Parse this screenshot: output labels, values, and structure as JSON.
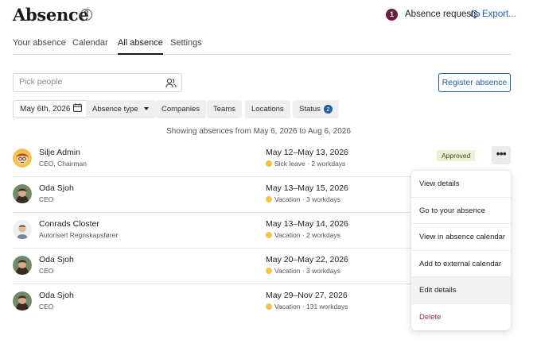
{
  "header": {
    "title": "Absence",
    "help_icon": "question-circle-icon",
    "requests_count": "1",
    "requests_label": "Absence requests",
    "export_label": "Export...",
    "accent_color": "#1f5fa6",
    "badge_color": "#6b1d3b"
  },
  "tabs": [
    {
      "label": "Your absence",
      "active": false
    },
    {
      "label": "Calendar",
      "active": false
    },
    {
      "label": "All absence",
      "active": true
    },
    {
      "label": "Settings",
      "active": false
    }
  ],
  "search": {
    "placeholder": "Pick people",
    "value": ""
  },
  "register_label": "Register absence",
  "filters": {
    "date": "May 6th, 2026",
    "absence_type": "Absence type",
    "companies": "Companies",
    "teams": "Teams",
    "locations": "Locations",
    "status": "Status",
    "status_count": "2"
  },
  "showing_text": "Showing absences from May 6, 2026 to Aug 6, 2026",
  "rows": [
    {
      "name": "Silje Admin",
      "role": "CEO, Chairman",
      "dates": "May 12–May 13, 2026",
      "type": "Sick leave",
      "workdays": "2 workdays",
      "status": "Approved",
      "avatar": "cartoon"
    },
    {
      "name": "Oda Sjoh",
      "role": "CEO",
      "dates": "May 13–May 15, 2026",
      "type": "Vacation",
      "workdays": "3 workdays",
      "avatar": "photo"
    },
    {
      "name": "Conrads Closter",
      "role": "Autorisert Regnskapsfører",
      "dates": "May 13–May 14, 2026",
      "type": "Vacation",
      "workdays": "2 workdays",
      "avatar": "photo-man"
    },
    {
      "name": "Oda Sjoh",
      "role": "CEO",
      "dates": "May 20–May 22, 2026",
      "type": "Vacation",
      "workdays": "3 workdays",
      "avatar": "photo"
    },
    {
      "name": "Oda Sjoh",
      "role": "CEO",
      "dates": "May 29–Nov 27, 2026",
      "type": "Vacation",
      "workdays": "131 workdays",
      "avatar": "photo"
    }
  ],
  "menu": {
    "items": [
      "View details",
      "Go to your absence",
      "View in absence calendar",
      "Add to external calendar",
      "Edit details",
      "Delete"
    ],
    "hovered": "Edit details"
  }
}
